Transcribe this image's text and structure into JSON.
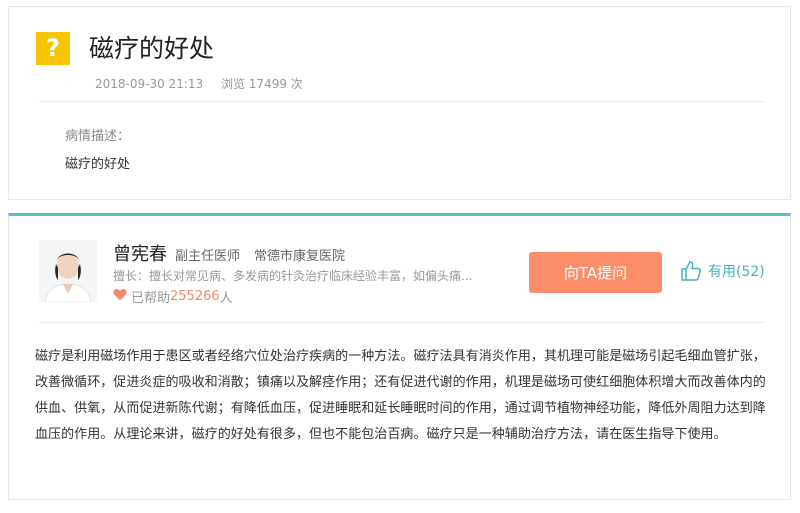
{
  "question": {
    "icon": "question-icon",
    "icon_glyph": "?",
    "title": "磁疗的好处",
    "date": "2018-09-30 21:13",
    "views": "浏览 17499 次",
    "desc_label": "病情描述：",
    "desc_text": "磁疗的好处"
  },
  "doctor": {
    "name": "曾宪春",
    "title": "副主任医师",
    "hospital": "常德市康复医院",
    "specialty": "擅长：擅长对常见病、多发病的针灸治疗临床经验丰富，如偏头痛...",
    "helped_prefix": "已帮助",
    "helped_count": "255266",
    "helped_suffix": "人",
    "ask_button": "向TA提问",
    "useful_label": "有用(52)"
  },
  "answer": {
    "text": "磁疗是利用磁场作用于患区或者经络穴位处治疗疾病的一种方法。磁疗法具有消炎作用，其机理可能是磁场引起毛细血管扩张，改善微循环，促进炎症的吸收和消散；镇痛以及解痉作用；还有促进代谢的作用，机理是磁场可使红细胞体积增大而改善体内的供血、供氧，从而促进新陈代谢；有降低血压，促进睡眠和延长睡眠时间的作用，通过调节植物神经功能，降低外周阻力达到降血压的作用。从理论来讲，磁疗的好处有很多，但也不能包治百病。磁疗只是一种辅助治疗方法，请在医生指导下使用。"
  },
  "colors": {
    "accent": "#56c1cf",
    "ask_button": "#fb8d6b",
    "question_icon": "#f7c500",
    "heart": "#f08c6a",
    "useful": "#45b3c1"
  }
}
